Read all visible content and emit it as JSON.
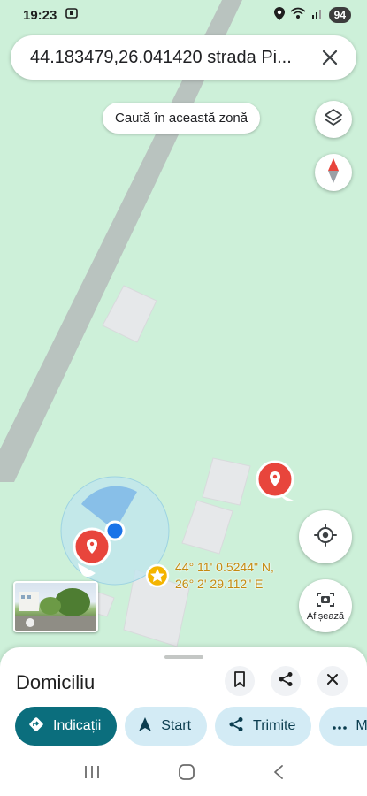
{
  "status_bar": {
    "time": "19:23",
    "battery": "94"
  },
  "search": {
    "query": "44.183479,26.041420 strada Pi..."
  },
  "map": {
    "search_this_area": "Caută în această zonă",
    "coordinates": {
      "lat": "44° 11' 0.5244\" N,",
      "lon": "26° 2' 29.112\" E"
    },
    "show_button_label": "Afișează",
    "colors": {
      "land": "#cdf0d9",
      "road": "#b9c3bf",
      "building": "#e6e8ea",
      "pin": "#e8453c",
      "location_dot": "#1a73e8",
      "accuracy_circle": "#bfe6ee",
      "star_marker": "#f4b400"
    }
  },
  "place": {
    "title": "Domiciliu"
  },
  "actions": [
    {
      "label": "Indicații",
      "icon": "directions-icon"
    },
    {
      "label": "Start",
      "icon": "navigation-icon"
    },
    {
      "label": "Trimite",
      "icon": "share-icon"
    },
    {
      "label": "M",
      "icon": "more-icon"
    }
  ]
}
